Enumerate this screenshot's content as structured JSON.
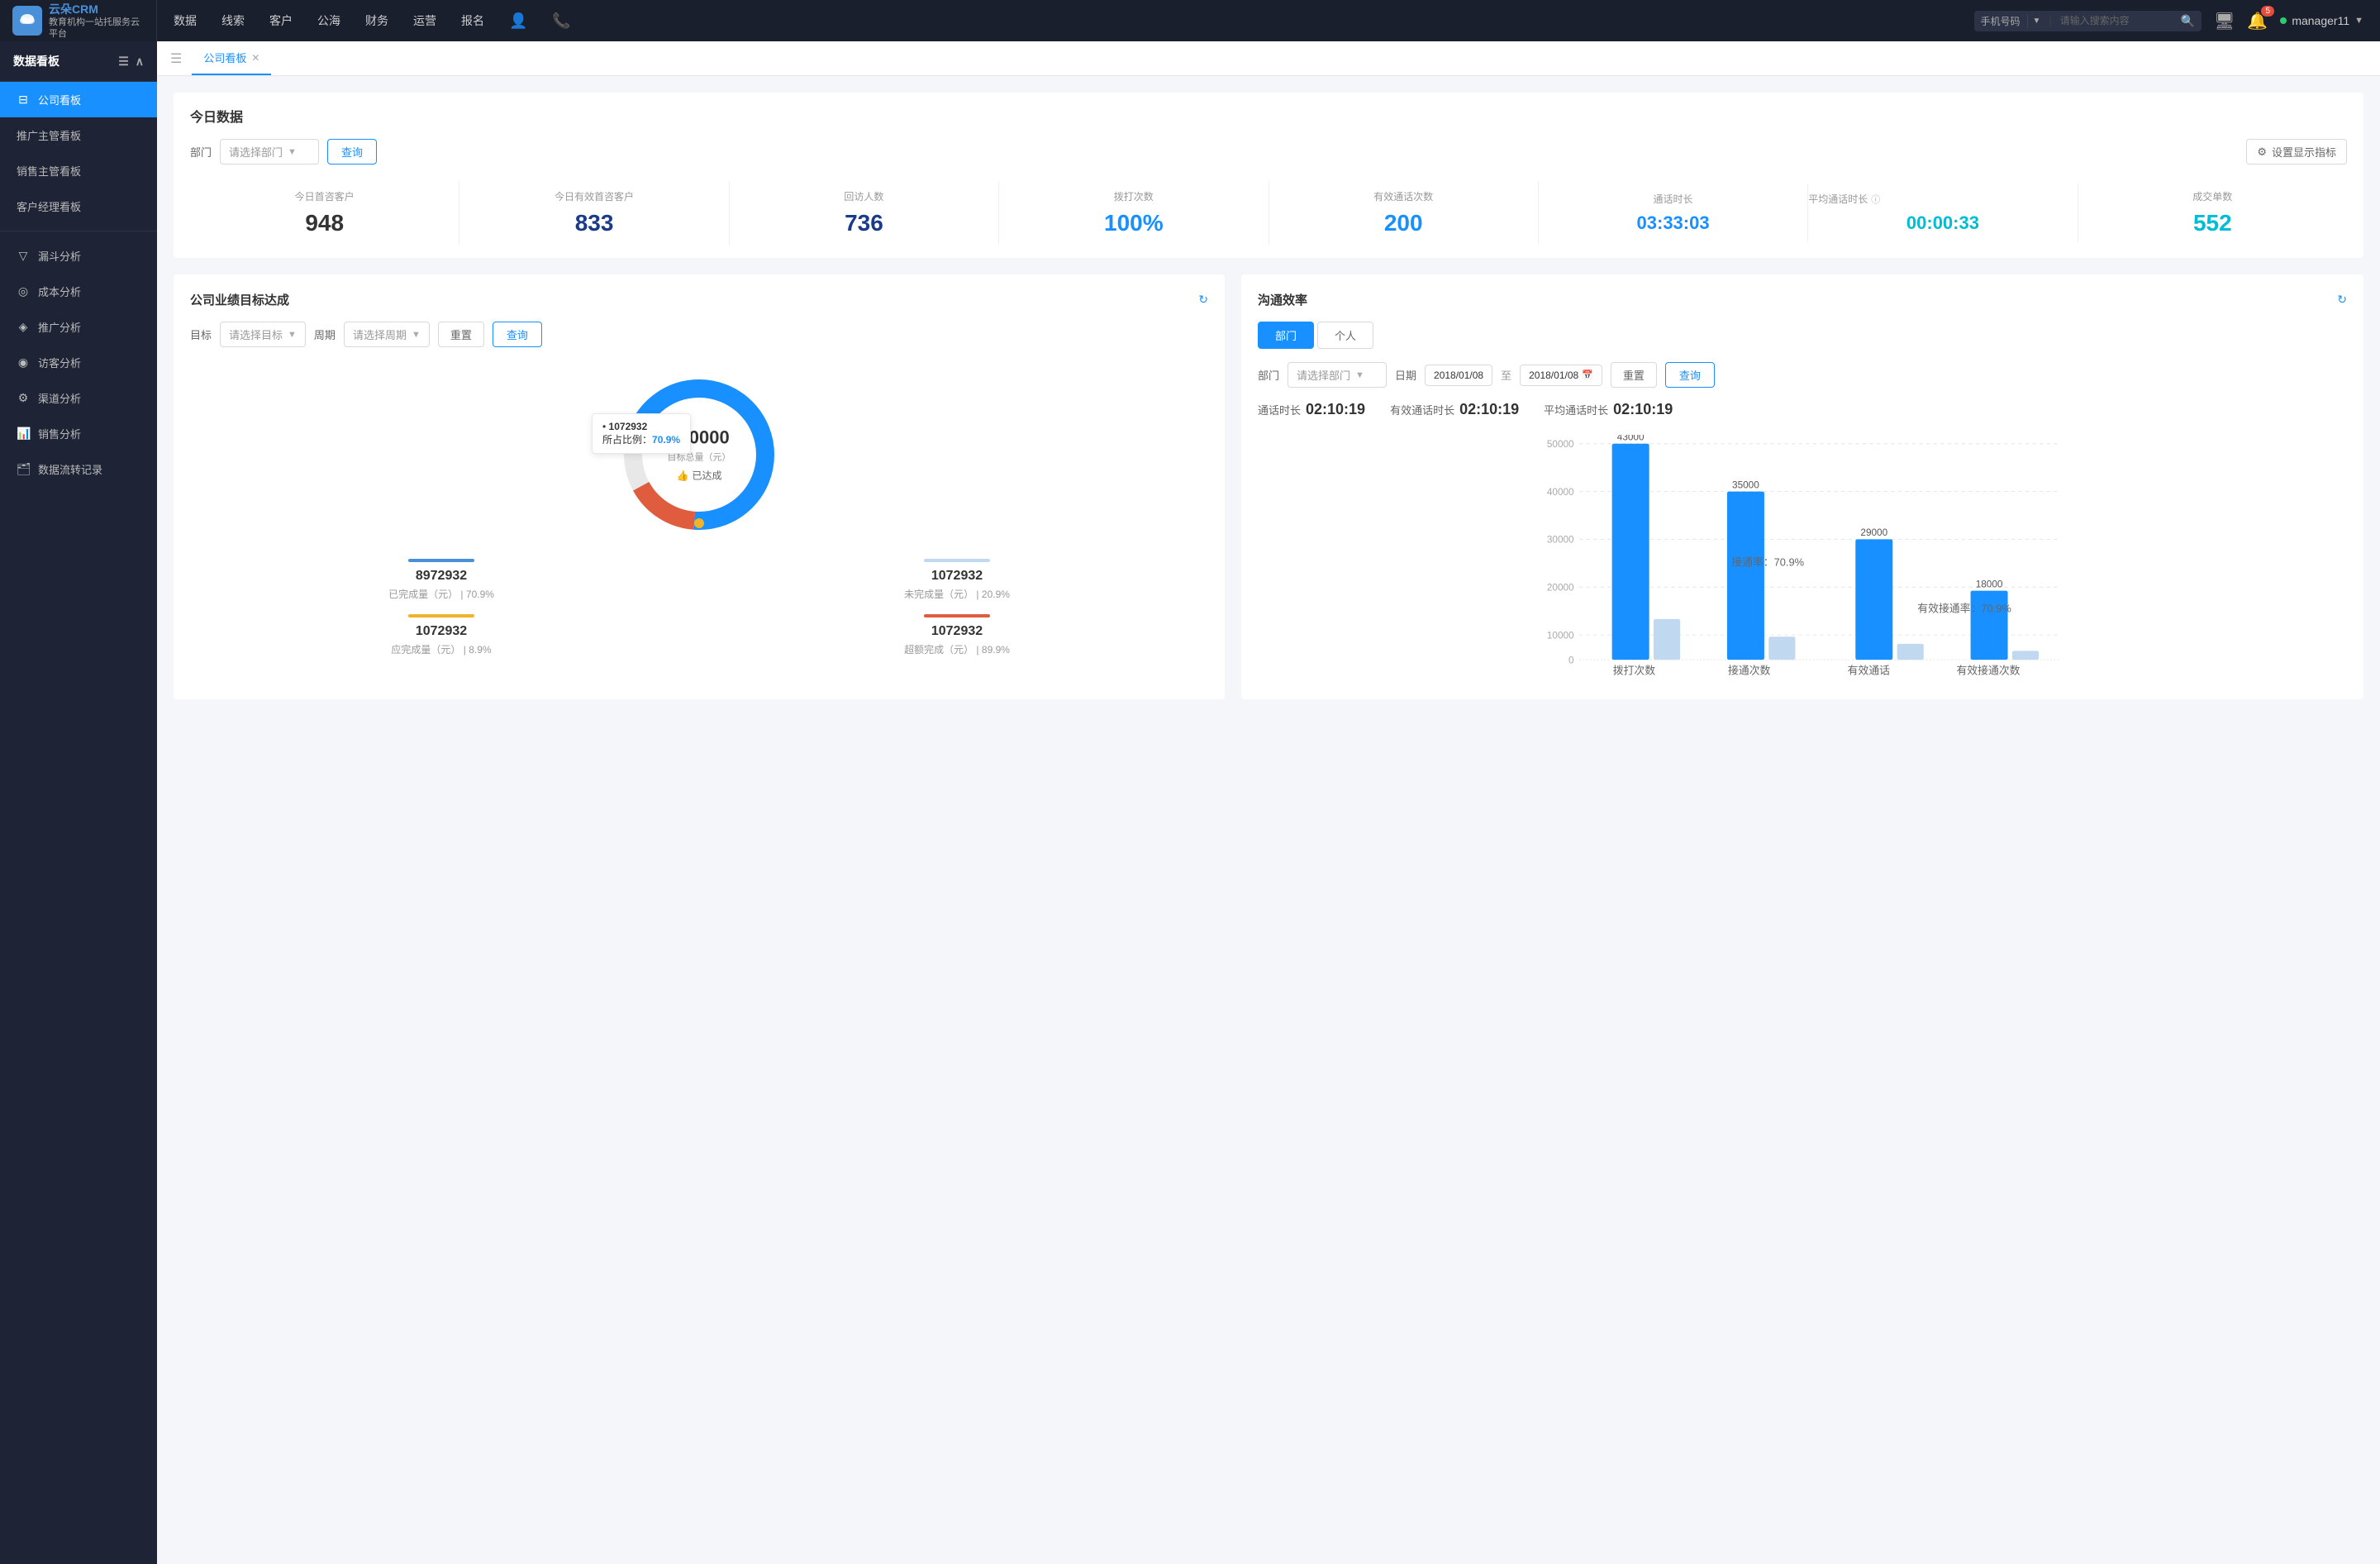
{
  "app": {
    "name": "云朵CRM",
    "tagline": "教育机构一站\n托服务云平台"
  },
  "topNav": {
    "items": [
      "数据",
      "线索",
      "客户",
      "公海",
      "财务",
      "运营",
      "报名"
    ],
    "search": {
      "type": "手机号码",
      "placeholder": "请输入搜索内容"
    },
    "notifications_count": "5",
    "username": "manager11"
  },
  "sidebar": {
    "header": "数据看板",
    "items": [
      {
        "label": "公司看板",
        "active": true,
        "icon": "🏠"
      },
      {
        "label": "推广主管看板",
        "active": false,
        "icon": ""
      },
      {
        "label": "销售主管看板",
        "active": false,
        "icon": ""
      },
      {
        "label": "客户经理看板",
        "active": false,
        "icon": ""
      }
    ],
    "sections": [
      {
        "label": "",
        "items": [
          {
            "label": "漏斗分析",
            "icon": "▽"
          },
          {
            "label": "成本分析",
            "icon": "◎"
          },
          {
            "label": "推广分析",
            "icon": "◈"
          },
          {
            "label": "访客分析",
            "icon": "◉"
          },
          {
            "label": "渠道分析",
            "icon": "⚙"
          },
          {
            "label": "销售分析",
            "icon": "📊"
          },
          {
            "label": "数据流转记录",
            "icon": "🗂"
          }
        ]
      }
    ]
  },
  "tabs": [
    {
      "label": "公司看板",
      "active": true,
      "closeable": true
    }
  ],
  "todayData": {
    "title": "今日数据",
    "filter": {
      "label": "部门",
      "placeholder": "请选择部门",
      "button": "查询"
    },
    "settings_button": "设置显示指标",
    "metrics": [
      {
        "label": "今日首咨客户",
        "value": "948",
        "color": "dark"
      },
      {
        "label": "今日有效首咨客户",
        "value": "833",
        "color": "dark-blue"
      },
      {
        "label": "回访人数",
        "value": "736",
        "color": "dark-blue"
      },
      {
        "label": "拨打次数",
        "value": "100%",
        "color": "blue"
      },
      {
        "label": "有效通话次数",
        "value": "200",
        "color": "blue"
      },
      {
        "label": "通话时长",
        "value": "03:33:03",
        "color": "blue"
      },
      {
        "label": "平均通话时长",
        "value": "00:00:33",
        "color": "cyan"
      },
      {
        "label": "成交单数",
        "value": "552",
        "color": "cyan"
      }
    ]
  },
  "goalPanel": {
    "title": "公司业绩目标达成",
    "filter": {
      "target_label": "目标",
      "target_placeholder": "请选择目标",
      "period_label": "周期",
      "period_placeholder": "请选择周期",
      "reset_btn": "重置",
      "query_btn": "查询"
    },
    "donut": {
      "center_value": "100000",
      "center_label": "目标总量（元）",
      "achieved_label": "已达成",
      "tooltip_value": "1072932",
      "tooltip_pct_label": "所占比例：",
      "tooltip_pct": "70.9%"
    },
    "stats": [
      {
        "label": "已完成量（元）",
        "sub": "70.9%",
        "value": "8972932",
        "color": "#4a90d9"
      },
      {
        "label": "未完成量（元）",
        "sub": "20.9%",
        "value": "1072932",
        "color": "#c0d8f0"
      },
      {
        "label": "应完成量（元）",
        "sub": "8.9%",
        "value": "1072932",
        "color": "#f0b429"
      },
      {
        "label": "超额完成（元）",
        "sub": "89.9%",
        "value": "1072932",
        "color": "#e05c3e"
      }
    ]
  },
  "commPanel": {
    "title": "沟通效率",
    "tabs": [
      {
        "label": "部门",
        "active": true
      },
      {
        "label": "个人",
        "active": false
      }
    ],
    "filter": {
      "dept_label": "部门",
      "dept_placeholder": "请选择部门",
      "date_label": "日期",
      "date_from": "2018/01/08",
      "date_to": "2018/01/08",
      "reset_btn": "重置",
      "query_btn": "查询"
    },
    "stats": [
      {
        "label": "通话时长",
        "value": "02:10:19"
      },
      {
        "label": "有效通话时长",
        "value": "02:10:19"
      },
      {
        "label": "平均通话时长",
        "value": "02:10:19"
      }
    ],
    "chart": {
      "yAxis": [
        50000,
        40000,
        30000,
        20000,
        10000,
        0
      ],
      "groups": [
        {
          "xLabel": "拨打次数",
          "bars": [
            {
              "value": 43000,
              "label": "43000",
              "color": "blue"
            },
            {
              "value": 18000,
              "label": "",
              "color": "light"
            }
          ],
          "annotation": ""
        },
        {
          "xLabel": "接通次数",
          "bars": [
            {
              "value": 35000,
              "label": "35000",
              "color": "blue"
            },
            {
              "value": 10000,
              "label": "",
              "color": "light"
            }
          ],
          "annotation": "接通率：70.9%"
        },
        {
          "xLabel": "有效通话",
          "bars": [
            {
              "value": 29000,
              "label": "29000",
              "color": "blue"
            },
            {
              "value": 8000,
              "label": "",
              "color": "light"
            }
          ],
          "annotation": ""
        },
        {
          "xLabel": "有效接通次数",
          "bars": [
            {
              "value": 18000,
              "label": "18000",
              "color": "blue"
            },
            {
              "value": 5000,
              "label": "",
              "color": "light"
            }
          ],
          "annotation": "有效接通率：70.9%"
        }
      ]
    }
  }
}
